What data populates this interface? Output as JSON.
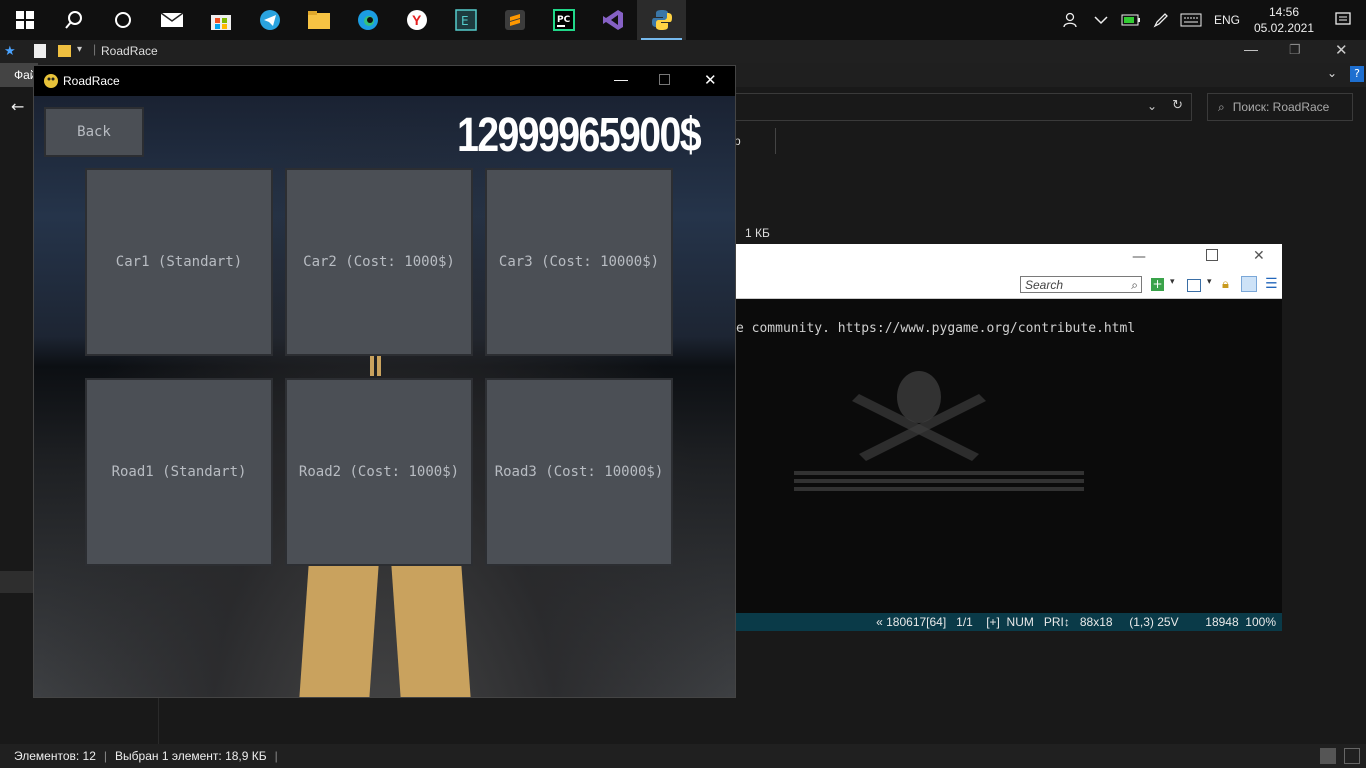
{
  "taskbar": {
    "apps": [
      "windows-start-icon",
      "search-icon",
      "cortana-icon",
      "mail-icon",
      "store-icon",
      "telegram-icon",
      "file-explorer-icon",
      "edge-icon",
      "yandex-browser-icon",
      "terminal-app-icon",
      "sublime-text-icon",
      "pycharm-icon",
      "visual-studio-icon",
      "python-icon"
    ],
    "lang": "ENG",
    "time": "14:56",
    "date": "05.02.2021"
  },
  "explorer": {
    "title": "RoadRace",
    "file_tab": "Фай",
    "search_placeholder": "Поиск: RoadRace",
    "fragment_p": "р",
    "size_fragment": "1 КБ",
    "status_items": "Элементов: 12",
    "status_selected": "Выбран 1 элемент: 18,9 КБ"
  },
  "viewer": {
    "search_placeholder": "Search",
    "console_line": "e community. https://www.pygame.org/contribute.html",
    "status": "« 180617[64]   1/1    [+]  NUM   PRI↕   88x18     (1,3) 25V        18948  100%"
  },
  "game": {
    "window_title": "RoadRace",
    "back_label": "Back",
    "money": "12999965900$",
    "cars": [
      "Car1 (Standart)",
      "Car2 (Cost: 1000$)",
      "Car3 (Cost: 10000$)"
    ],
    "roads": [
      "Road1 (Standart)",
      "Road2 (Cost: 1000$)",
      "Road3 (Cost: 10000$)"
    ]
  }
}
